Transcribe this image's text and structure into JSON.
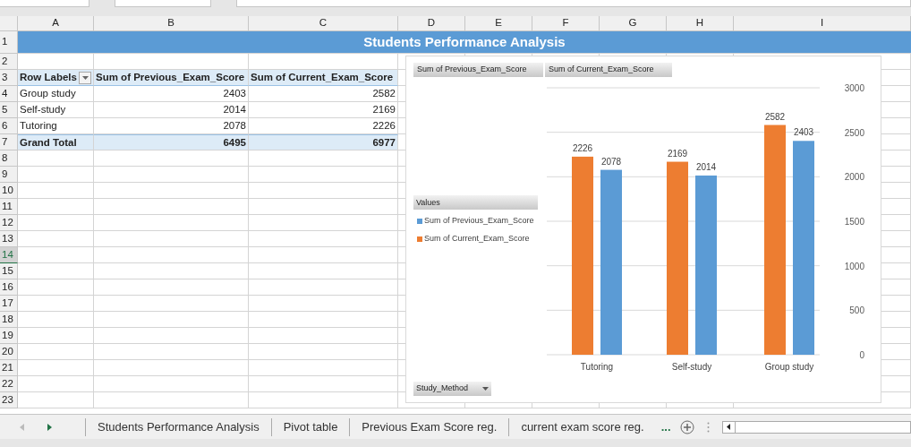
{
  "columns": [
    "A",
    "B",
    "C",
    "D",
    "E",
    "F",
    "G",
    "H",
    "I"
  ],
  "rows": [
    {
      "label": "1",
      "selected": false
    },
    {
      "label": "2",
      "selected": false
    },
    {
      "label": "3",
      "selected": false
    },
    {
      "label": "4",
      "selected": false
    },
    {
      "label": "5",
      "selected": false
    },
    {
      "label": "6",
      "selected": false
    },
    {
      "label": "7",
      "selected": false
    },
    {
      "label": "8",
      "selected": false
    },
    {
      "label": "9",
      "selected": false
    },
    {
      "label": "10",
      "selected": false
    },
    {
      "label": "11",
      "selected": false
    },
    {
      "label": "12",
      "selected": false
    },
    {
      "label": "13",
      "selected": false
    },
    {
      "label": "14",
      "selected": true
    },
    {
      "label": "15",
      "selected": false
    },
    {
      "label": "16",
      "selected": false
    },
    {
      "label": "17",
      "selected": false
    },
    {
      "label": "18",
      "selected": false
    },
    {
      "label": "19",
      "selected": false
    },
    {
      "label": "20",
      "selected": false
    },
    {
      "label": "21",
      "selected": false
    },
    {
      "label": "22",
      "selected": false
    },
    {
      "label": "23",
      "selected": false
    }
  ],
  "title": "Students Performance Analysis",
  "pivot": {
    "header": [
      "Row Labels",
      "Sum of Previous_Exam_Score",
      "Sum of Current_Exam_Score"
    ],
    "rows": [
      {
        "label": "Group study",
        "values": [
          "2403",
          "2582"
        ]
      },
      {
        "label": "Self-study",
        "values": [
          "2014",
          "2169"
        ]
      },
      {
        "label": "Tutoring",
        "values": [
          "2078",
          "2226"
        ]
      }
    ],
    "total": {
      "label": "Grand Total",
      "values": [
        "6495",
        "6977"
      ]
    }
  },
  "pivot_chart": {
    "field_buttons": [
      "Sum of Previous_Exam_Score",
      "Sum of Current_Exam_Score"
    ],
    "legend": {
      "title": "Values"
    },
    "axis_button": "Study_Method",
    "chart_data": {
      "type": "bar",
      "categories": [
        "Tutoring",
        "Self-study",
        "Group study"
      ],
      "series": [
        {
          "name": "Sum of Current_Exam_Score",
          "color": "#ed7d31",
          "values": [
            2226,
            2169,
            2582
          ]
        },
        {
          "name": "Sum of Previous_Exam_Score",
          "color": "#5b9bd5",
          "values": [
            2078,
            2014,
            2403
          ]
        }
      ],
      "ylim": [
        0,
        3000
      ],
      "yticks": [
        0,
        500,
        1000,
        1500,
        2000,
        2500,
        3000
      ],
      "grid": true,
      "data_labels": true
    }
  },
  "sheet_tabs": [
    "Students Performance Analysis",
    "Pivot table",
    "Previous Exam Score reg.",
    "current exam score reg."
  ],
  "more_tabs": "..."
}
